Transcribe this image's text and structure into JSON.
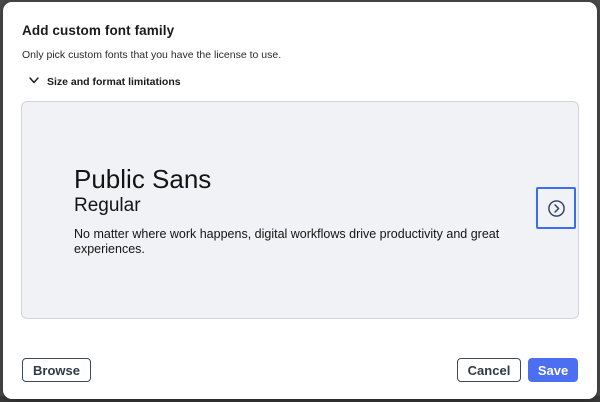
{
  "dialog": {
    "title": "Add custom font family",
    "subtitle": "Only pick custom fonts that you have the license to use.",
    "disclosure": {
      "label": "Size and format limitations",
      "icon": "chevron-down-icon",
      "expanded": false
    }
  },
  "preview": {
    "font_name": "Public Sans",
    "font_style": "Regular",
    "sample_text": "No matter where work happens, digital workflows drive productivity and great experiences.",
    "next_icon": "chevron-right-circle-icon"
  },
  "footer": {
    "browse_label": "Browse",
    "cancel_label": "Cancel",
    "save_label": "Save"
  },
  "colors": {
    "accent": "#4c6ef0",
    "focus_ring": "#3b6df0",
    "preview_bg": "#f1f2f5",
    "outline_button_border": "#3e4a55"
  }
}
